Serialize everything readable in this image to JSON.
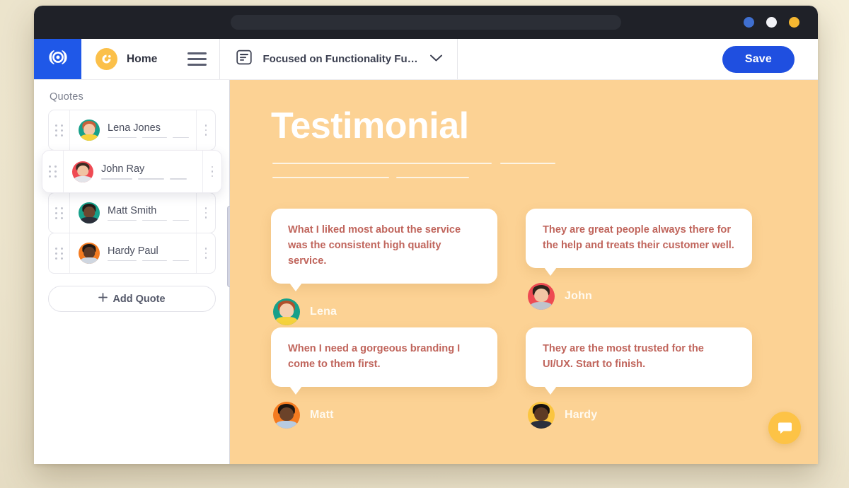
{
  "window": {
    "titlebar_dots": [
      "#3f6fd0",
      "#f2f3f7",
      "#f5b731"
    ]
  },
  "toolbar": {
    "logo_icon": "brand-logo-icon",
    "home_label": "Home",
    "home_avatar_icon": "home-avatar-icon",
    "menu_icon": "hamburger-menu-icon",
    "doc_icon": "document-icon",
    "doc_title": "Focused on Functionality Fue...",
    "chevron_icon": "chevron-down-icon",
    "save_label": "Save",
    "save_color": "#1f4fe0"
  },
  "sidebar": {
    "title": "Quotes",
    "items": [
      {
        "name": "Lena Jones",
        "avatar_bg": "#17a08a",
        "hair": "#c9603a",
        "skin": "#f3c9a8",
        "shirt": "#f5d23c",
        "active": false
      },
      {
        "name": "John Ray",
        "avatar_bg": "#ef4a53",
        "hair": "#3a2b23",
        "skin": "#f0c3a3",
        "shirt": "#e3e4e9",
        "active": true
      },
      {
        "name": "Matt Smith",
        "avatar_bg": "#17a08a",
        "hair": "#221a16",
        "skin": "#6d4630",
        "shirt": "#2b2f3a",
        "active": false
      },
      {
        "name": "Hardy Paul",
        "avatar_bg": "#f47b20",
        "hair": "#1d1714",
        "skin": "#5d3a26",
        "shirt": "#cfd6e0",
        "active": false
      }
    ],
    "drag_handle_icon": "drag-handle-icon",
    "row_menu_icon": "more-vertical-icon",
    "add_quote_label": "Add Quote",
    "add_icon": "plus-icon",
    "scrollbar_icon": "vertical-scrollbar"
  },
  "canvas": {
    "background": "#fcd294",
    "heading": "Testimonial",
    "testimonials": [
      {
        "quote": "What  I liked most about the service was the consistent high quality service.",
        "author": "Lena",
        "avatar_bg": "#17a08a",
        "hair": "#b0502c",
        "skin": "#f5cfae",
        "shirt": "#f5d23c"
      },
      {
        "quote": "They are great people always there for the help and treats their customer well.",
        "author": "John",
        "avatar_bg": "#ee4a52",
        "hair": "#2f231c",
        "skin": "#f1c5a4",
        "shirt": "#bfc3cc"
      },
      {
        "quote": "When I need a gorgeous branding I come to them first.",
        "author": "Matt",
        "avatar_bg": "#f47b20",
        "hair": "#1c1511",
        "skin": "#6b4229",
        "shirt": "#b8cbe0"
      },
      {
        "quote": "They are the most trusted for the UI/UX. Start to finish.",
        "author": "Hardy",
        "avatar_bg": "#fbc53f",
        "hair": "#171210",
        "skin": "#5e3a24",
        "shirt": "#2a2f3c"
      }
    ],
    "quote_text_color": "#c0655c",
    "fab_icon": "chat-bubble-icon"
  }
}
